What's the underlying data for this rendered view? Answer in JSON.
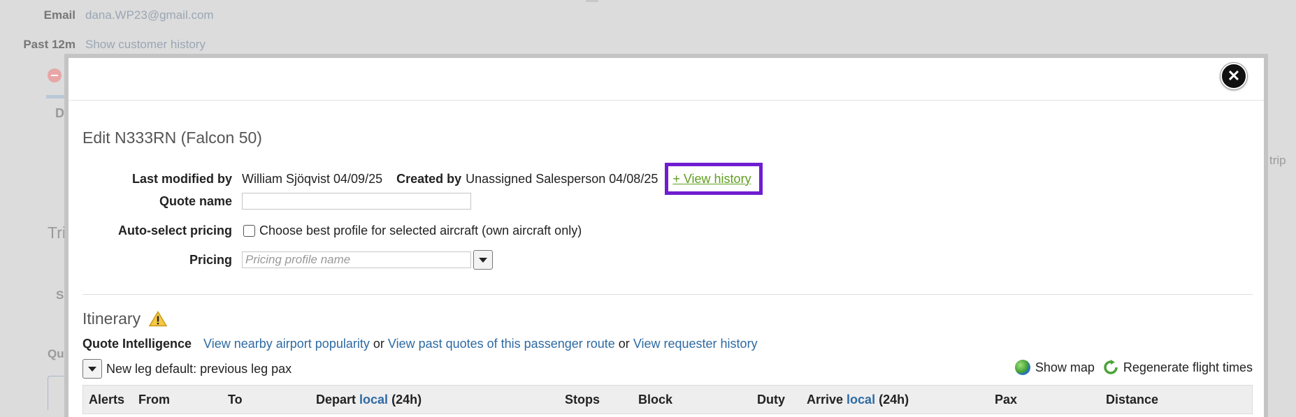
{
  "background": {
    "email_label": "Email",
    "email_value": "dana.WP23@gmail.com",
    "past_label": "Past 12m",
    "past_link": "Show customer history",
    "frag_tab": "D",
    "frag_trip_section": "Tri",
    "frag_s": "S",
    "frag_qu": "Qu",
    "frag_trip": "trip"
  },
  "modal": {
    "close_icon": "close-icon",
    "title": "Edit N333RN (Falcon 50)",
    "last_modified_label": "Last modified by",
    "last_modified_value": "William Sjöqvist 04/09/25",
    "created_label": "Created by",
    "created_value": "Unassigned Salesperson 04/08/25",
    "view_history": "+ View history",
    "quote_name_label": "Quote name",
    "quote_name_value": "",
    "auto_select_label": "Auto-select pricing",
    "auto_select_text": "Choose best profile for selected aircraft (own aircraft only)",
    "pricing_label": "Pricing",
    "pricing_placeholder": "Pricing profile name",
    "itinerary_title": "Itinerary",
    "quote_intel_label": "Quote Intelligence",
    "link_popularity": "View nearby airport popularity",
    "or1": "or",
    "link_past_quotes": "View past quotes of this passenger route",
    "or2": "or",
    "link_requester": "View requester history",
    "new_leg_default": "New leg default: previous leg pax",
    "show_map": "Show map",
    "regenerate": "Regenerate flight times",
    "columns": {
      "alerts": "Alerts",
      "from": "From",
      "to": "To",
      "depart": "Depart",
      "depart_local": "local",
      "depart_suffix": "(24h)",
      "stops": "Stops",
      "block": "Block",
      "duty": "Duty",
      "arrive": "Arrive",
      "arrive_local": "local",
      "arrive_suffix": "(24h)",
      "pax": "Pax",
      "distance": "Distance"
    }
  },
  "colors": {
    "highlight_box": "#6f1dd0",
    "history_link": "#5f9e1f",
    "link": "#2e6aa3"
  }
}
